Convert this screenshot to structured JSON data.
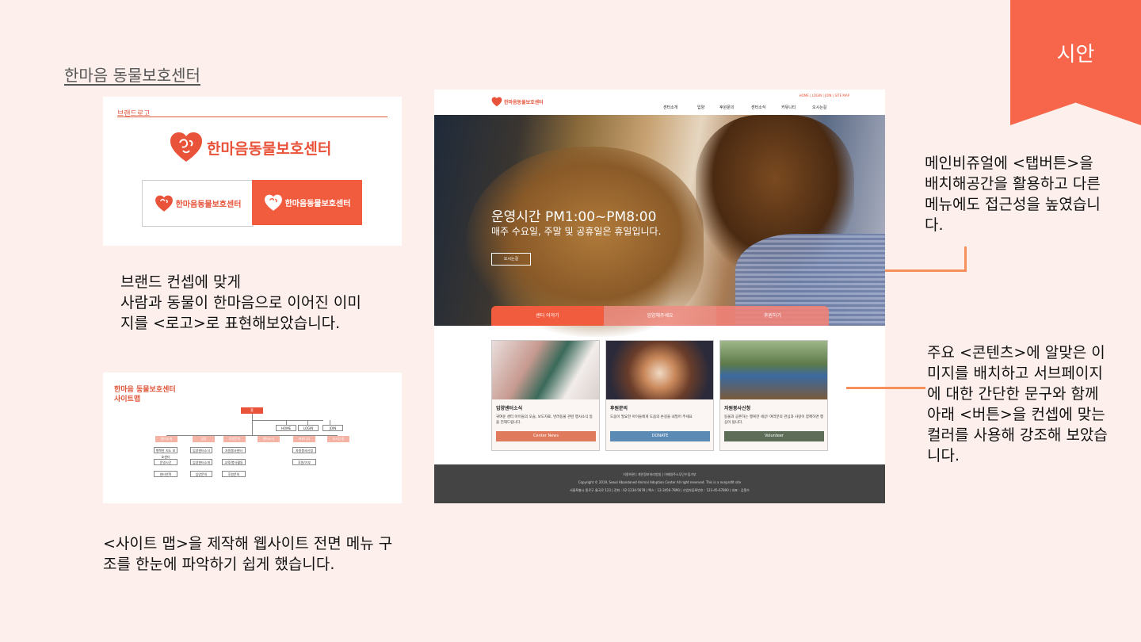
{
  "ribbon_label": "시안",
  "page_title": "한마음 동물보호센터",
  "brand_card": {
    "label": "브랜드로고",
    "logo_text": "한마음동물보호센터",
    "logo_white_text": "한마음동물보호센터",
    "logo_orange_text": "한마음동물보호센터"
  },
  "brand_desc": "브랜드 컨셉에 맞게\n사람과 동물이 한마음으로 이어진 이미\n지를 <로고>로 표현해보았습니다.",
  "sitemap": {
    "title": "한마음 동물보호센터\n사이트맵",
    "root": "홈",
    "util": [
      "HOME",
      "LOGIN",
      "JOIN"
    ],
    "categories": [
      "센터소개",
      "입양",
      "후원문의",
      "센터소식",
      "커뮤니티",
      "오시는길"
    ],
    "subs": [
      [
        "행복한 지도 보호센터",
        "운영시간",
        "센터연혁"
      ],
      [
        "입양센터소식",
        "입양센터소개",
        "입양문의"
      ],
      [
        "자원봉사센터",
        "교육/봉사활동",
        "후원문의"
      ],
      [
        "자원봉사신청",
        "후원/기부"
      ]
    ]
  },
  "sitemap_desc": "<사이트 맵>을 제작해 웹사이트 전면 메뉴 구\n조를 한눈에 파악하기 쉽게 했습니다.",
  "mockup": {
    "logo_text": "한마음동물보호센터",
    "util_links": "HOME  |  LOGIN  |  JOIN  |  SITE MAP",
    "nav": [
      "센터소개",
      "입양",
      "후원문의",
      "센터소식",
      "커뮤니티",
      "오시는길"
    ],
    "hero_title": "운영시간 PM1:00~PM8:00",
    "hero_subtitle": "매주 수요일, 주말 및 공휴일은 휴일입니다.",
    "hero_button": "오시는길",
    "tabs": [
      "센터 이야기",
      "입양해주세요",
      "후원하기"
    ],
    "cards": [
      {
        "title": "입양센터소식",
        "desc": "귀여운 센터 아이들의 모습, 보도자료, 반려동물 관련 행사소식 등을 전해드립니다.",
        "button": "Center News"
      },
      {
        "title": "후원문의",
        "desc": "도움이 필요한 아이들에게 도움의 손길을 내밀어 주세요",
        "button": "DONATE"
      },
      {
        "title": "자원봉사신청",
        "desc": "동물과 공존하는 행복한 세상! 여러분의 관심과 사랑이 함께하면 행심이 됩니다.",
        "button": "Volunteer"
      }
    ],
    "footer_links": "이용약관  |  개인정보처리방침  |  이메일주소무단수집거부",
    "footer_copy": "Copyright © 2019, Seoul Abandoned Animal Adoption Center All right reserved. This is a nonprofit site",
    "footer_addr": "서울특별시 종로구 율곡로 123 | 전화 : 02-1234-5678 | 팩스 : 12-3456-7890 | 사업자등록번호 : 123-45-67890 | 대표 : 김철수"
  },
  "right_desc_1": "메인비쥬얼에 <탭버튼>을\n배치해공간을 활용하고 다른\n메뉴에도 접근성을 높였습니\n다.",
  "right_desc_2": "주요 <콘텐츠>에 알맞은 이\n미지를 배치하고 서브페이지\n에 대한 간단한 문구와 함께\n아래 <버튼>을 컨셉에 맞는\n컬러를 사용해 강조해 보았습\n니다.",
  "colors": {
    "accent": "#f7664a",
    "news": "#e07a5c",
    "donate": "#5b8ab5",
    "volunteer": "#5d6d58",
    "footer": "#444444"
  }
}
